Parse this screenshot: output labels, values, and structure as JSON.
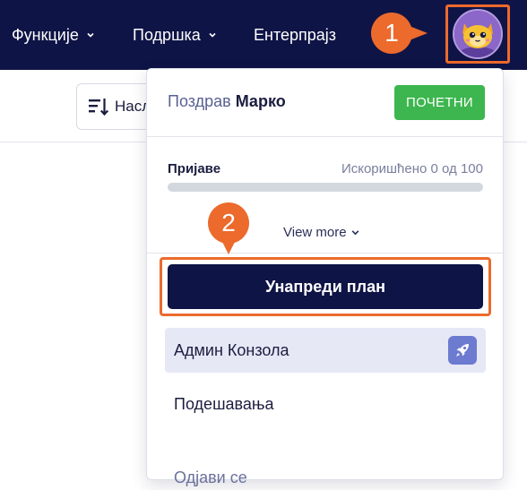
{
  "nav": {
    "features": "Функције",
    "support": "Подршка",
    "enterprise": "Ентерпрајз"
  },
  "toolbar": {
    "sort_label": "Насл"
  },
  "annotations": {
    "step_1": "1",
    "step_2": "2"
  },
  "dropdown": {
    "greeting_prefix": "Поздрав",
    "user_name": "Марко",
    "plan_badge": "ПОЧЕТНИ",
    "usage_label": "Пријаве",
    "usage_count": "Искоришћено 0 од 100",
    "usage_fraction": 0,
    "view_more": "View more",
    "upgrade_button": "Унапреди план",
    "admin_console": "Админ Конзола",
    "settings": "Подешавања",
    "logout": "Одјави се"
  },
  "colors": {
    "navbar": "#0f1446",
    "accent_orange": "#ec6a2c",
    "badge_green": "#3db64f",
    "admin_highlight": "#e6e8f6"
  },
  "icons": {
    "nav_chevron": "chevron-down-icon",
    "sort": "sort-icon",
    "avatar": "cat-avatar",
    "view_more": "chevron-down-icon",
    "admin": "rocket-icon"
  }
}
